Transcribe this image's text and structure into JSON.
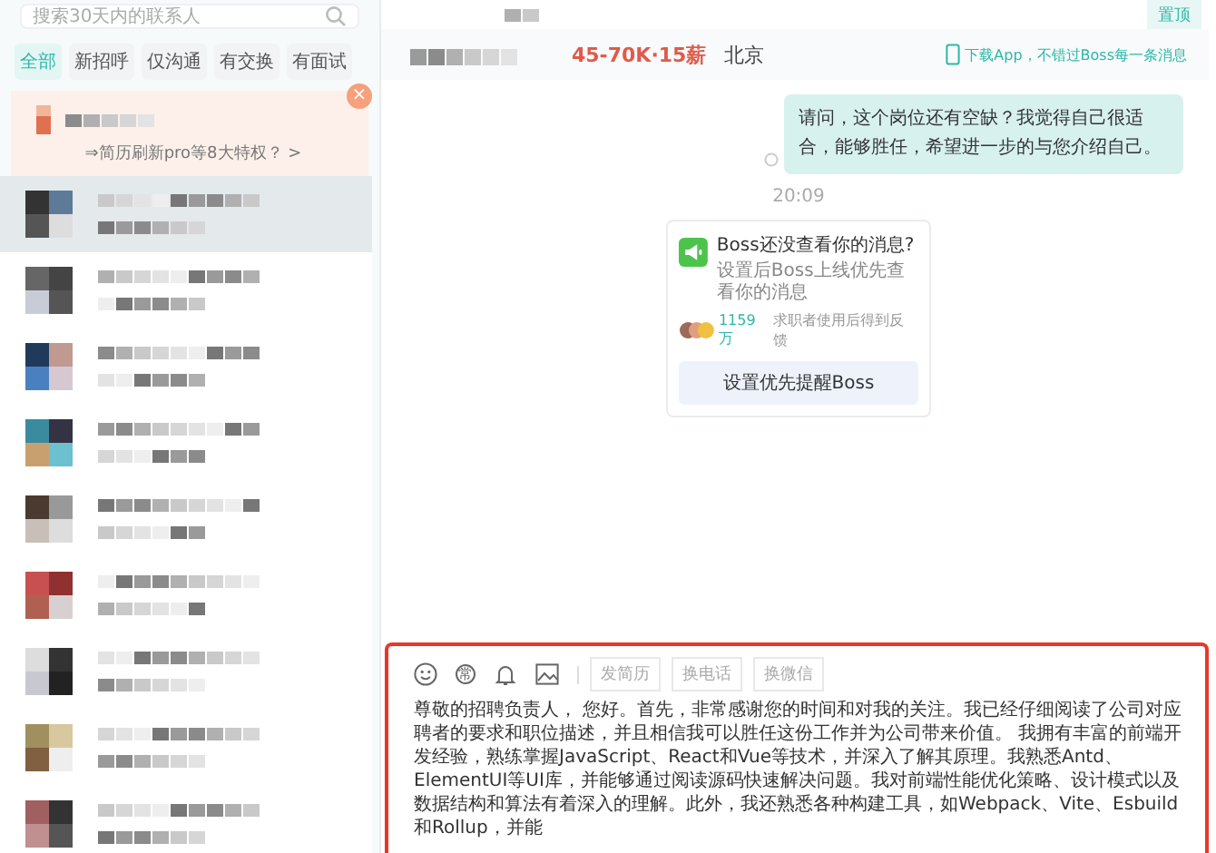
{
  "sidebar": {
    "search": {
      "placeholder": "搜索30天内的联系人"
    },
    "filters": [
      {
        "label": "全部",
        "selected": true
      },
      {
        "label": "新招呼",
        "selected": false
      },
      {
        "label": "仅沟通",
        "selected": false
      },
      {
        "label": "有交换",
        "selected": false
      },
      {
        "label": "有面试",
        "selected": false
      }
    ],
    "promo": {
      "text": "⇒简历刷新pro等8大特权？ >",
      "close": "×"
    },
    "contacts": [
      {
        "selected": true
      },
      {
        "selected": false
      },
      {
        "selected": false
      },
      {
        "selected": false
      },
      {
        "selected": false
      },
      {
        "selected": false
      },
      {
        "selected": false
      },
      {
        "selected": false
      },
      {
        "selected": false
      }
    ]
  },
  "chat": {
    "pin_button": "置顶",
    "header": {
      "salary": "45-70K·15薪",
      "city": "北京",
      "app_notice": "下载App，不错过Boss每一条消息"
    },
    "messages": [
      {
        "kind": "bubble",
        "text": "请问，这个岗位还有空缺？我觉得自己很适合，能够胜任，希望进一步的与您介绍自己。",
        "read": false
      },
      {
        "kind": "time",
        "text": "20:09"
      },
      {
        "kind": "card",
        "title": "Boss还没查看你的消息?",
        "text": "设置后Boss上线优先查看你的消息",
        "count": "1159万",
        "count_text": "求职者使用后得到反馈",
        "button": "设置优先提醒Boss"
      }
    ],
    "composer": {
      "highlighted": true,
      "tools": [
        {
          "kind": "emoji"
        },
        {
          "kind": "glyph",
          "text": "常"
        },
        {
          "kind": "bell"
        },
        {
          "kind": "image"
        }
      ],
      "actions": [
        {
          "label": "发简历",
          "disabled": true
        },
        {
          "label": "换电话",
          "disabled": true
        },
        {
          "label": "换微信",
          "disabled": true
        }
      ],
      "value": "尊敬的招聘负责人， 您好。首先，非常感谢您的时间和对我的关注。我已经仔细阅读了公司对应聘者的要求和职位描述，并且相信我可以胜任这份工作并为公司带来价值。 我拥有丰富的前端开发经验，熟练掌握JavaScript、React和Vue等技术，并深入了解其原理。我熟悉Antd、ElementUI等UI库，并能够通过阅读源码快速解决问题。我对前端性能优化策略、设计模式以及数据结构和算法有着深入的理解。此外，我还熟悉各种构建工具，如Webpack、Vite、Esbuild和Rollup，并能"
    }
  }
}
